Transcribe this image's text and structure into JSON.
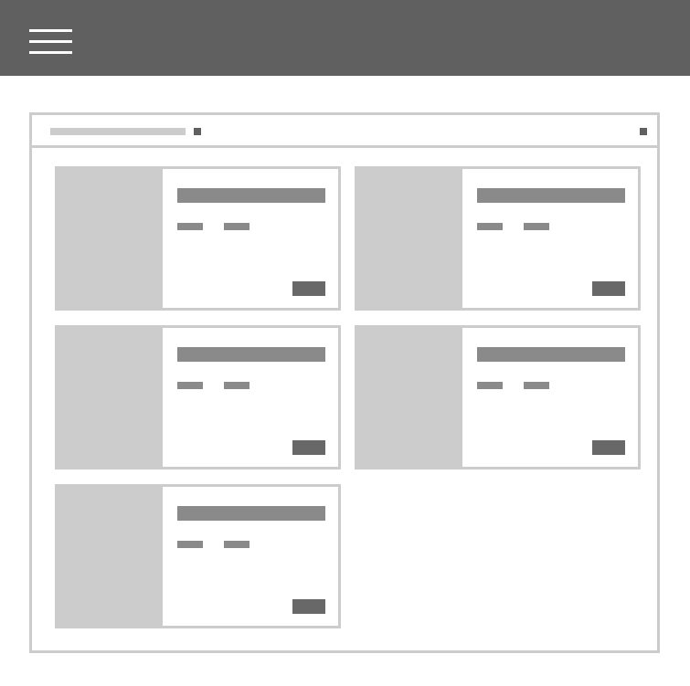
{
  "header": {
    "menu_icon": "hamburger-menu-icon",
    "background": "#606060"
  },
  "panel": {
    "title_placeholder": true,
    "border_color": "#cccccc"
  },
  "cards": [
    {
      "id": "card-1",
      "thumbnail": "image-placeholder",
      "title": "",
      "meta": [
        "",
        ""
      ],
      "action": ""
    },
    {
      "id": "card-2",
      "thumbnail": "image-placeholder",
      "title": "",
      "meta": [
        "",
        ""
      ],
      "action": ""
    },
    {
      "id": "card-3",
      "thumbnail": "image-placeholder",
      "title": "",
      "meta": [
        "",
        ""
      ],
      "action": ""
    },
    {
      "id": "card-4",
      "thumbnail": "image-placeholder",
      "title": "",
      "meta": [
        "",
        ""
      ],
      "action": ""
    },
    {
      "id": "card-5",
      "thumbnail": "image-placeholder",
      "title": "",
      "meta": [
        "",
        ""
      ],
      "action": ""
    }
  ]
}
